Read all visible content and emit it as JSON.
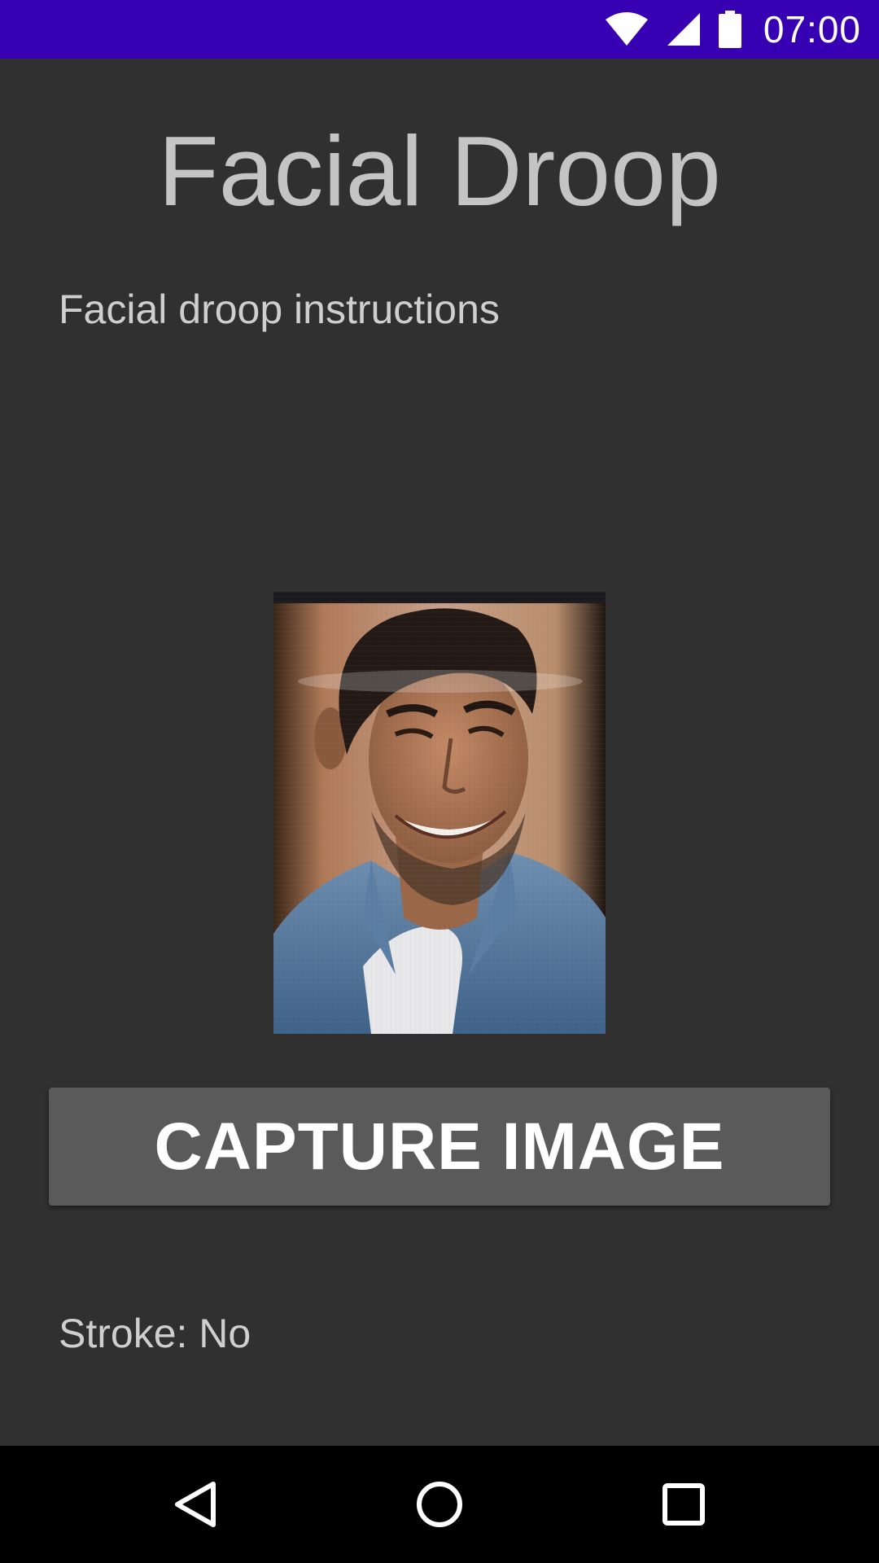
{
  "status_bar": {
    "time": "07:00",
    "icons": [
      "wifi-icon",
      "cell-signal-icon",
      "battery-icon"
    ],
    "background": "#3700b3"
  },
  "main": {
    "title": "Facial Droop",
    "instructions": "Facial droop instructions",
    "capture_button_label": "CAPTURE IMAGE",
    "stroke_result": "Stroke: No"
  },
  "nav_bar": {
    "buttons": [
      "back-icon",
      "home-icon",
      "recents-icon"
    ]
  },
  "colors": {
    "background": "#303030",
    "button": "#5a5a5b",
    "text": "#cfcfcf"
  }
}
